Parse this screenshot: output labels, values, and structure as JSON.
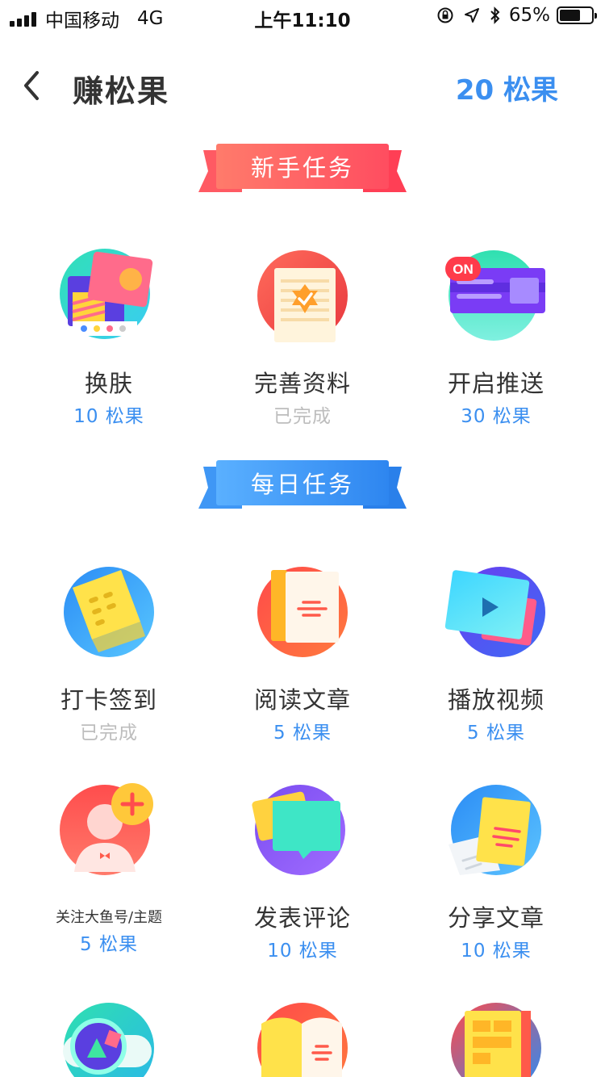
{
  "status_bar": {
    "carrier": "中国移动",
    "network": "4G",
    "time": "上午11:10",
    "battery_text": "65%",
    "battery_level": 0.65
  },
  "nav": {
    "title": "赚松果",
    "points": "20 松果"
  },
  "sections": {
    "newbie": {
      "title": "新手任务"
    },
    "daily": {
      "title": "每日任务"
    }
  },
  "newbie_tasks": [
    {
      "name": "换肤",
      "reward": "10 松果",
      "icon": "skin-icon"
    },
    {
      "name": "完善资料",
      "reward": "已完成",
      "icon": "profile-badge-icon"
    },
    {
      "name": "开启推送",
      "reward": "30 松果",
      "icon": "push-toggle-icon",
      "badge": "ON"
    }
  ],
  "daily_tasks": [
    {
      "name": "打卡签到",
      "reward": "已完成",
      "icon": "checkin-ticket-icon"
    },
    {
      "name": "阅读文章",
      "reward": "5 松果",
      "icon": "article-icon"
    },
    {
      "name": "播放视频",
      "reward": "5 松果",
      "icon": "video-play-icon"
    },
    {
      "name": "关注大鱼号/主题",
      "reward": "5 松果",
      "icon": "follow-add-icon"
    },
    {
      "name": "发表评论",
      "reward": "10 松果",
      "icon": "comment-icon"
    },
    {
      "name": "分享文章",
      "reward": "10 松果",
      "icon": "share-article-icon"
    },
    {
      "name": "",
      "reward": "",
      "icon": "explore-search-icon"
    },
    {
      "name": "",
      "reward": "",
      "icon": "open-book-icon"
    },
    {
      "name": "",
      "reward": "",
      "icon": "news-page-icon"
    }
  ],
  "colors": {
    "accent": "#3b8ff0",
    "done": "#bdbdbd",
    "ribbon_red": "#ff5a63",
    "ribbon_blue": "#3f97f5"
  }
}
